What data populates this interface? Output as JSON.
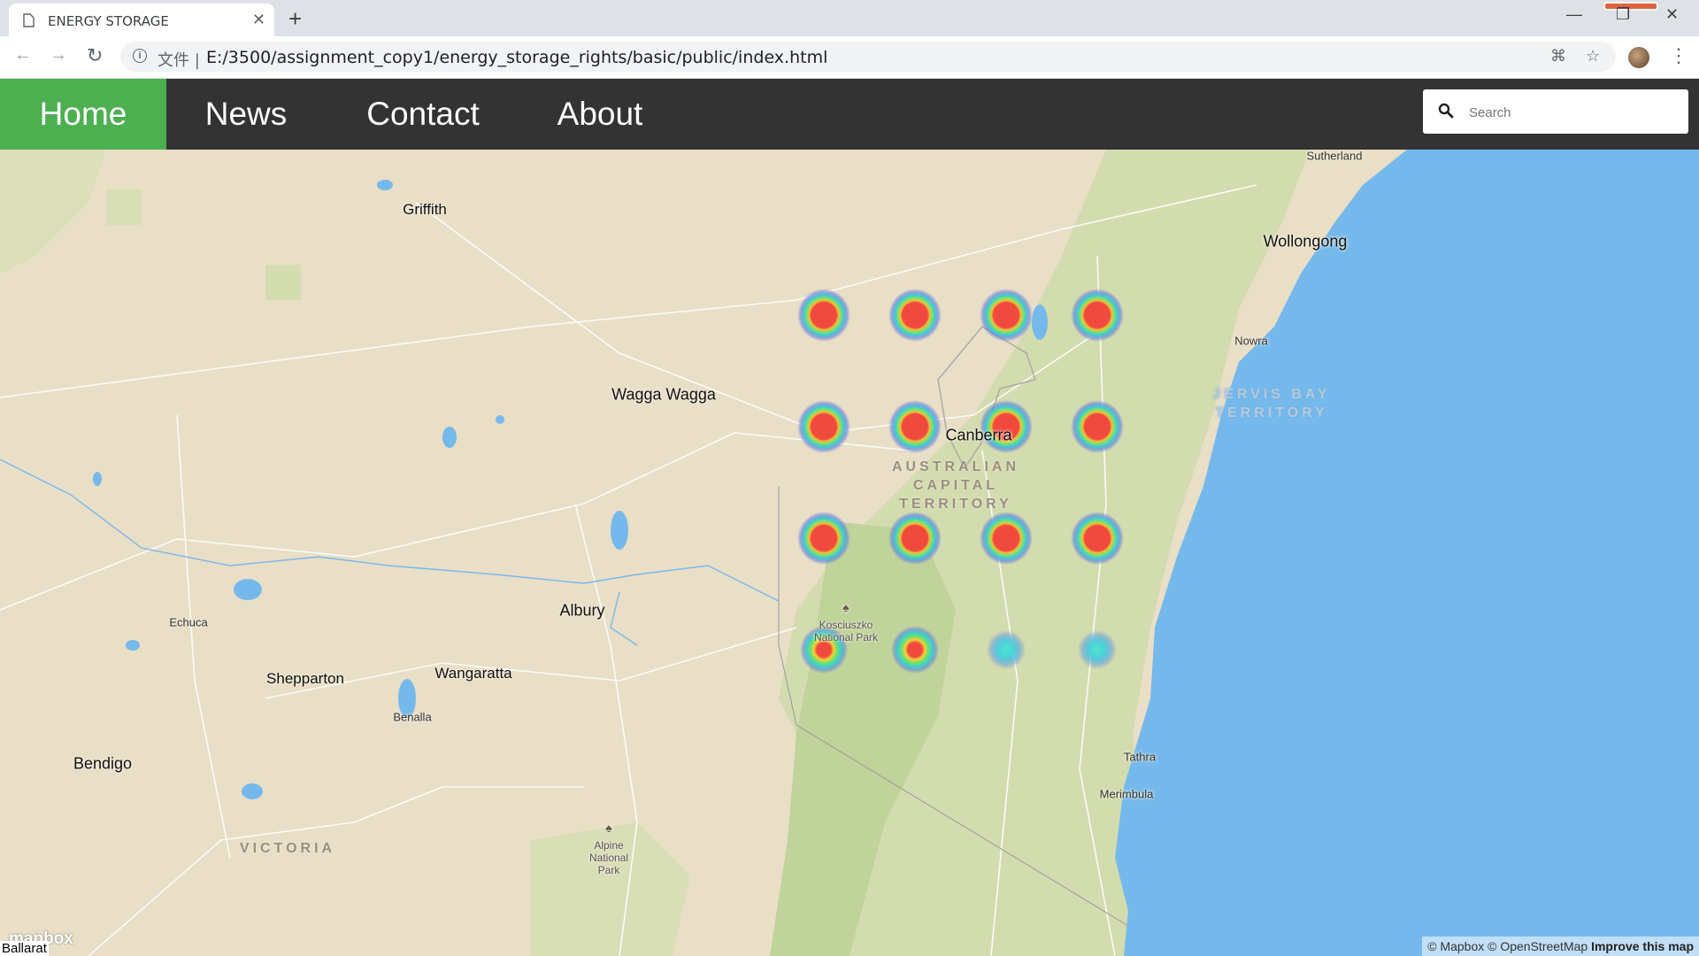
{
  "browser": {
    "tab_title": "ENERGY STORAGE",
    "tab_close": "✕",
    "new_tab": "+",
    "file_label": "文件 |",
    "url": "E:/3500/assignment_copy1/energy_storage_rights/basic/public/index.html",
    "back_icon": "arrow-left-icon",
    "forward_icon": "arrow-right-icon",
    "reload_icon": "reload-icon"
  },
  "nav": {
    "items": [
      {
        "label": "Home",
        "active": true
      },
      {
        "label": "News",
        "active": false
      },
      {
        "label": "Contact",
        "active": false
      },
      {
        "label": "About",
        "active": false
      }
    ],
    "search_placeholder": "Search"
  },
  "map": {
    "places": [
      {
        "name": "Sutherland"
      },
      {
        "name": "Griffith"
      },
      {
        "name": "Wollongong"
      },
      {
        "name": "Nowra"
      },
      {
        "name": "Wagga Wagga"
      },
      {
        "name": "Canberra"
      },
      {
        "name": "Albury"
      },
      {
        "name": "Echuca"
      },
      {
        "name": "Shepparton"
      },
      {
        "name": "Wangaratta"
      },
      {
        "name": "Benalla"
      },
      {
        "name": "Bendigo"
      },
      {
        "name": "Tathra"
      },
      {
        "name": "Merimbula"
      }
    ],
    "regions": [
      {
        "name": "JERVIS BAY"
      },
      {
        "name": "TERRITORY"
      },
      {
        "name": "AUSTRALIAN"
      },
      {
        "name": "CAPITAL"
      },
      {
        "name": "TERRITORY"
      },
      {
        "name": "VICTORIA"
      }
    ],
    "parks": [
      {
        "name": "Kosciuszko\nNational Park"
      },
      {
        "name": "Alpine\nNational\nPark"
      }
    ],
    "heatmap_points": [
      {
        "row": 0,
        "col": 0,
        "intensity": "high"
      },
      {
        "row": 0,
        "col": 1,
        "intensity": "high"
      },
      {
        "row": 0,
        "col": 2,
        "intensity": "high"
      },
      {
        "row": 0,
        "col": 3,
        "intensity": "high"
      },
      {
        "row": 1,
        "col": 0,
        "intensity": "high"
      },
      {
        "row": 1,
        "col": 1,
        "intensity": "high"
      },
      {
        "row": 1,
        "col": 2,
        "intensity": "high"
      },
      {
        "row": 1,
        "col": 3,
        "intensity": "high"
      },
      {
        "row": 2,
        "col": 0,
        "intensity": "high"
      },
      {
        "row": 2,
        "col": 1,
        "intensity": "high"
      },
      {
        "row": 2,
        "col": 2,
        "intensity": "high"
      },
      {
        "row": 2,
        "col": 3,
        "intensity": "high"
      },
      {
        "row": 3,
        "col": 0,
        "intensity": "medium"
      },
      {
        "row": 3,
        "col": 1,
        "intensity": "medium"
      },
      {
        "row": 3,
        "col": 2,
        "intensity": "low"
      },
      {
        "row": 3,
        "col": 3,
        "intensity": "low"
      }
    ],
    "attribution": "© Mapbox © OpenStreetMap",
    "improve": "Improve this map",
    "logo": "mapbox",
    "bottom_label": "Ballarat"
  },
  "colors": {
    "nav_bg": "#333333",
    "nav_active": "#4caf50",
    "land": "#e9dec6",
    "sea": "#75b9ec",
    "park": "#c9d9a4"
  }
}
